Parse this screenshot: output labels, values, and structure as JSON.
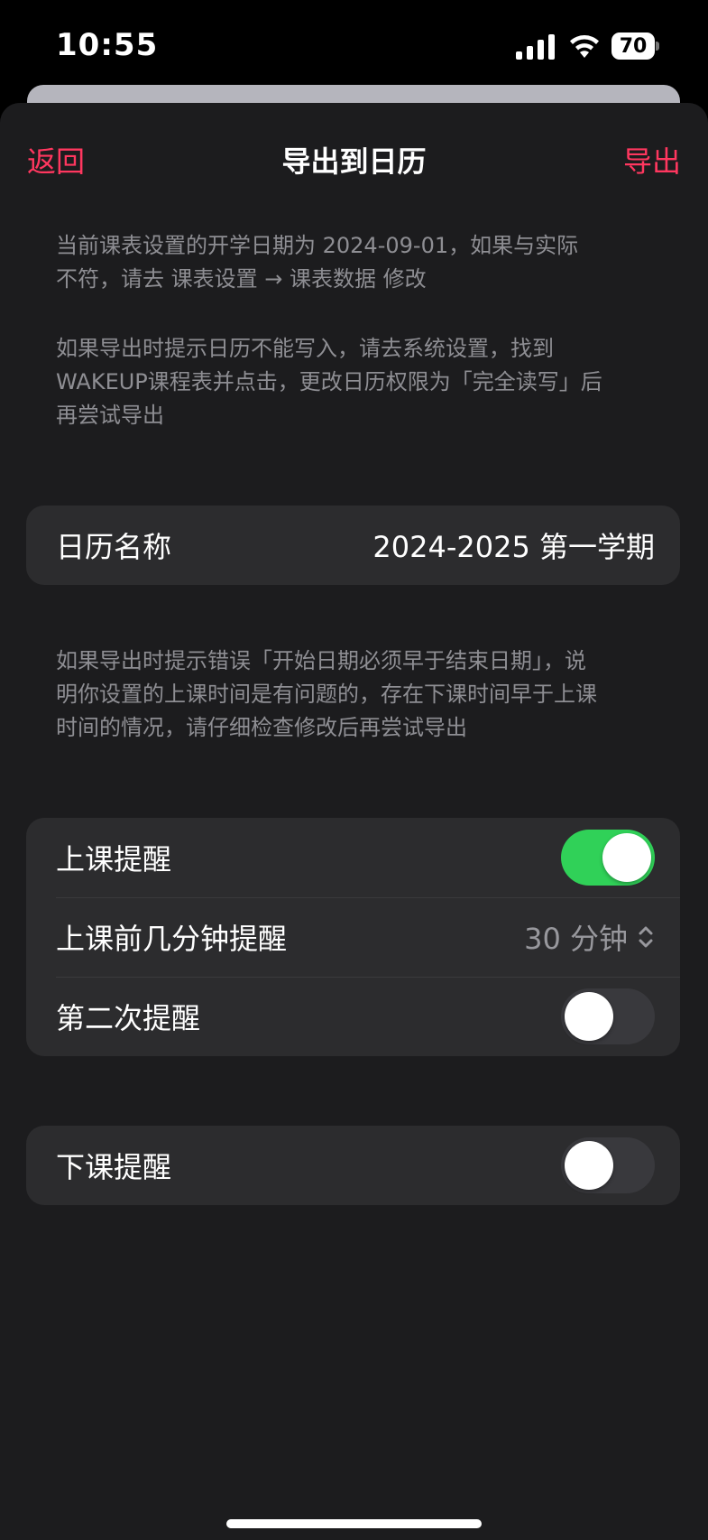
{
  "status_bar": {
    "time": "10:55",
    "battery": "70"
  },
  "nav": {
    "back_label": "返回",
    "title": "导出到日历",
    "export_label": "导出"
  },
  "notes": {
    "start_date_line1": "当前课表设置的开学日期为 2024-09-01，如果与实际",
    "start_date_line2": "不符，请去 课表设置 → 课表数据 修改",
    "permission_line1": "如果导出时提示日历不能写入，请去系统设置，找到",
    "permission_line2": "WAKEUP课程表并点击，更改日历权限为「完全读写」后",
    "permission_line3": "再尝试导出",
    "error_line1": "如果导出时提示错误「开始日期必须早于结束日期」，说",
    "error_line2": "明你设置的上课时间是有问题的，存在下课时间早于上课",
    "error_line3": "时间的情况，请仔细检查修改后再尝试导出"
  },
  "calendar_name": {
    "label": "日历名称",
    "value": "2024-2025 第一学期"
  },
  "reminders": {
    "class_reminder_label": "上课提醒",
    "class_reminder_on": true,
    "minutes_before_label": "上课前几分钟提醒",
    "minutes_before_value": "30 分钟",
    "second_reminder_label": "第二次提醒",
    "second_reminder_on": false
  },
  "end_reminder": {
    "label": "下课提醒",
    "on": false
  },
  "colors": {
    "accent": "#ff375f",
    "toggle_on": "#30d158",
    "toggle_off": "#39393d",
    "sheet_bg": "#1c1c1e",
    "group_bg": "#2c2c2e"
  }
}
